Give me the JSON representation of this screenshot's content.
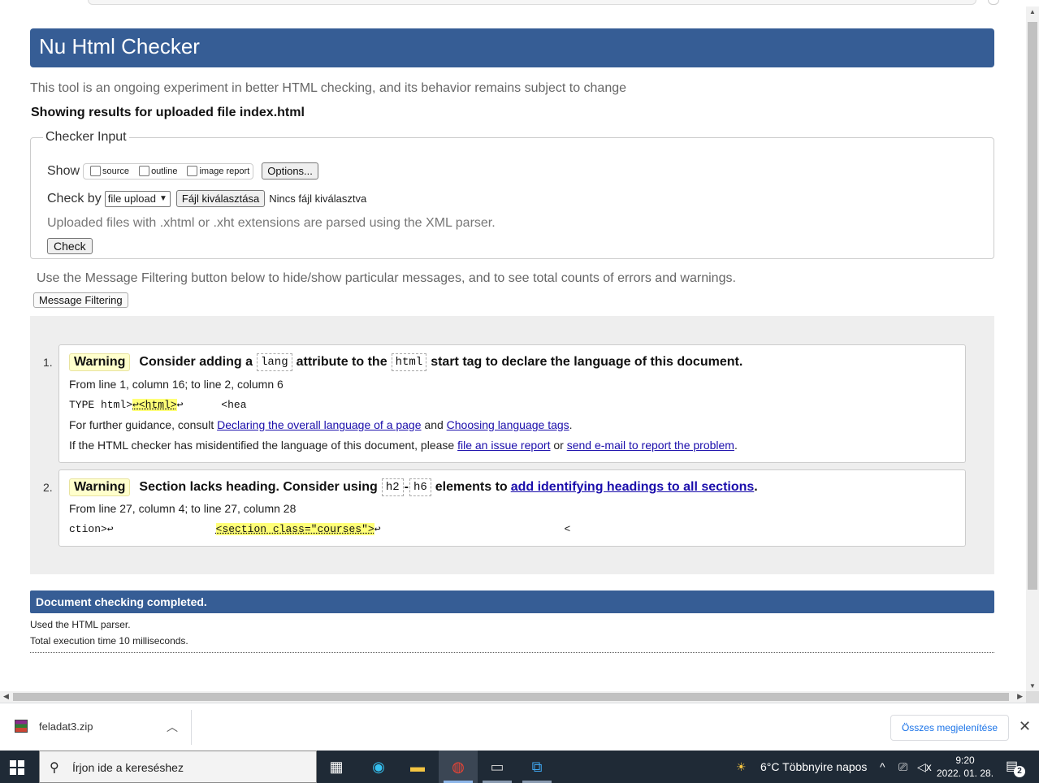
{
  "header": {
    "title": "Nu Html Checker"
  },
  "intro": "This tool is an ongoing experiment in better HTML checking, and its behavior remains subject to change",
  "showing": "Showing results for uploaded file index.html",
  "checker_input": {
    "legend": "Checker Input",
    "show_label": "Show",
    "options": [
      "source",
      "outline",
      "image report"
    ],
    "options_button": "Options...",
    "check_by_label": "Check by",
    "check_by_value": "file upload",
    "file_button": "Fájl kiválasztása",
    "no_file": "Nincs fájl kiválasztva",
    "xml_note": "Uploaded files with .xhtml or .xht extensions are parsed using the XML parser.",
    "check_button": "Check"
  },
  "filter": {
    "note": "Use the Message Filtering button below to hide/show particular messages, and to see total counts of errors and warnings.",
    "button": "Message Filtering"
  },
  "messages": [
    {
      "num": "1.",
      "type": "Warning",
      "text_a": "Consider adding a",
      "code_a": "lang",
      "text_b": "attribute to the",
      "code_b": "html",
      "text_c": "start tag to declare the language of this document.",
      "location": "From line 1, column 16; to line 2, column 6",
      "extract_pre": "TYPE html>",
      "extract_hl": "↩<html>",
      "extract_post": "↩      <hea",
      "guidance_pre": "For further guidance, consult",
      "link1": "Declaring the overall language of a page",
      "guidance_and": "and",
      "link2": "Choosing language tags",
      "guidance_end": ".",
      "misid_pre": "If the HTML checker has misidentified the language of this document, please",
      "link3": "file an issue report",
      "misid_or": "or",
      "link4": "send e-mail to report the problem",
      "misid_end": "."
    },
    {
      "num": "2.",
      "type": "Warning",
      "text_a": "Section lacks heading. Consider using",
      "code_a": "h2",
      "dash": "-",
      "code_b": "h6",
      "text_b": "elements to",
      "link": "add identifying headings to all sections",
      "text_end": ".",
      "location": "From line 27, column 4; to line 27, column 28",
      "extract_pre": "ction>↩",
      "extract_hl": "<section class=\"courses\">",
      "extract_post": "↩",
      "extract_tail": "<"
    }
  ],
  "done": {
    "title": "Document checking completed.",
    "parser": "Used the HTML parser.",
    "time": "Total execution time 10 milliseconds."
  },
  "downloads": {
    "file": "feladat3.zip",
    "show_all": "Összes megjelenítése"
  },
  "taskbar": {
    "search_placeholder": "Írjon ide a kereséshez",
    "weather": "6°C  Többnyire napos",
    "time": "9:20",
    "date": "2022. 01. 28.",
    "notifications": "2"
  }
}
